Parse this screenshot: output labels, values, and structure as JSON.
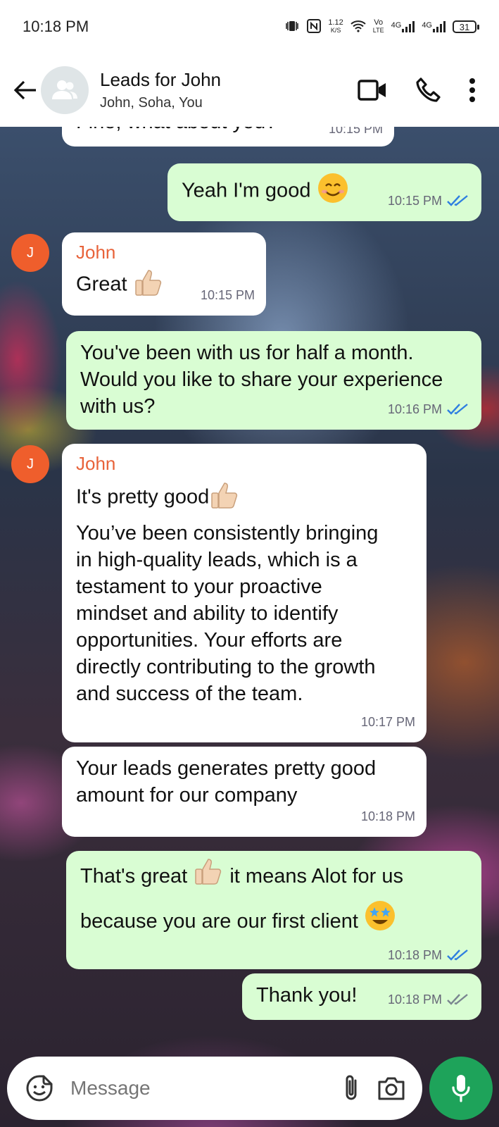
{
  "status_bar": {
    "time": "10:18 PM",
    "speed": "1.12",
    "speed_unit": "K/S",
    "volte_top": "Vo",
    "volte_bottom": "LTE",
    "net1": "4G",
    "net2": "4G",
    "battery": "31"
  },
  "header": {
    "title": "Leads for John",
    "subtitle": "John, Soha, You"
  },
  "messages": [
    {
      "direction": "in",
      "text": "Fine, what about you?",
      "time": "10:15 PM"
    },
    {
      "direction": "out",
      "text": "Yeah I'm good",
      "emoji": "smiling-face",
      "time": "10:15 PM",
      "ticks": "read"
    },
    {
      "direction": "in",
      "sender": "John",
      "avatar": "J",
      "text": "Great",
      "emoji": "thumbs-up",
      "time": "10:15 PM"
    },
    {
      "direction": "out",
      "text": "You've been with us for half a month. Would you like to share your experience with us?",
      "time": "10:16 PM",
      "ticks": "read"
    },
    {
      "direction": "in",
      "sender": "John",
      "avatar": "J",
      "text_line1": "It's pretty good",
      "emoji": "thumbs-up",
      "text": "You’ve been consistently bringing in high-quality leads, which is a testament to your proactive mindset and ability to identify opportunities. Your efforts are directly contributing to the growth and success of the team.",
      "time": "10:17 PM"
    },
    {
      "direction": "in",
      "text": "Your leads generates pretty good amount for our company",
      "time": "10:18 PM"
    },
    {
      "direction": "out",
      "text_a": "That's great",
      "text_b": "it means Alot for us",
      "text_c": "because you are our first client",
      "time": "10:18 PM",
      "ticks": "read"
    },
    {
      "direction": "out",
      "text": "Thank you!",
      "time": "10:18 PM",
      "ticks": "delivered"
    }
  ],
  "input": {
    "placeholder": "Message"
  },
  "colors": {
    "outgoing_bubble": "#d9fdd3",
    "incoming_bubble": "#ffffff",
    "sender_name": "#e8633a",
    "read_tick": "#2f7fe0",
    "mic_button": "#1ea35a"
  }
}
